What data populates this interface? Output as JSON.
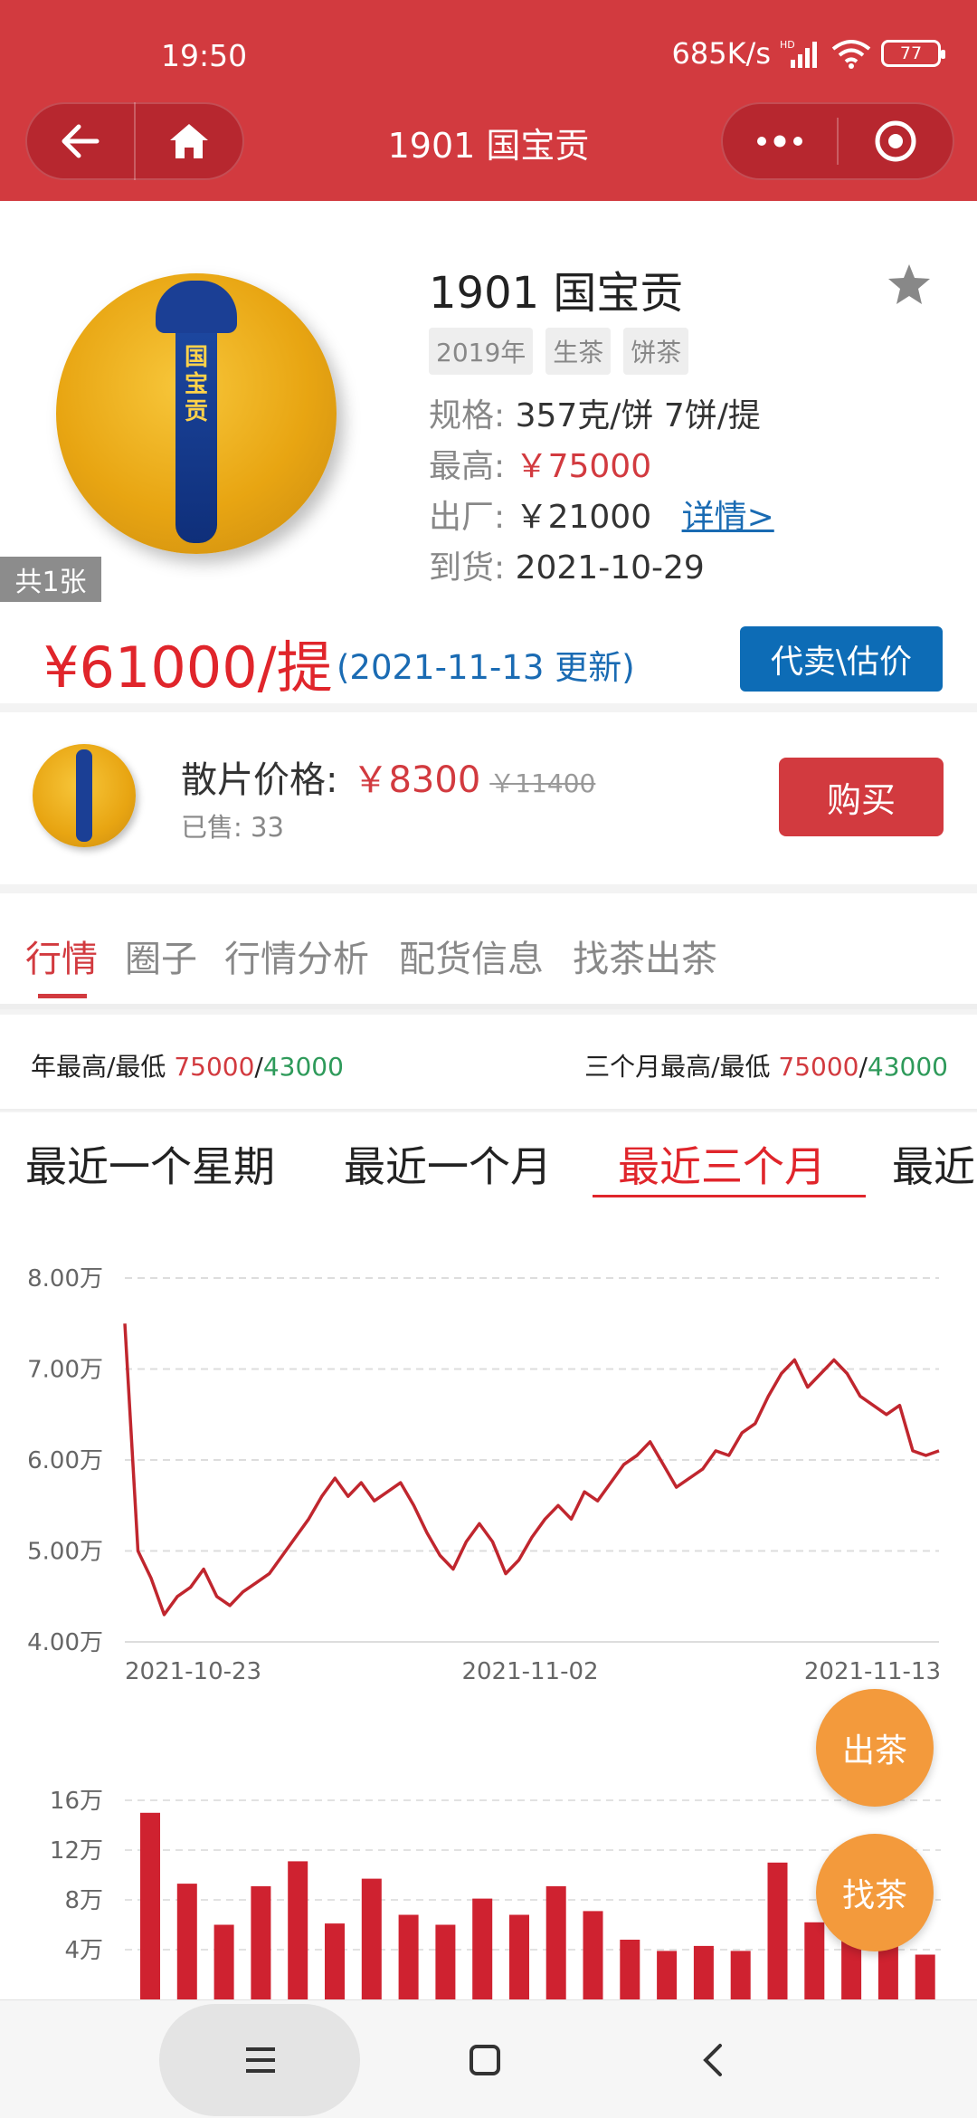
{
  "status": {
    "time": "19:50",
    "network": "685K/s",
    "hd": "HD",
    "battery": "77"
  },
  "nav": {
    "title": "1901 国宝贡"
  },
  "product": {
    "photo_count": "共1张",
    "title": "1901 国宝贡",
    "tags": [
      "2019年",
      "生茶",
      "饼茶"
    ],
    "spec_label": "规格:",
    "spec_value": "357克/饼 7饼/提",
    "max_label": "最高:",
    "max_value": "￥75000",
    "factory_label": "出厂:",
    "factory_value": "￥21000",
    "detail_link": "详情>",
    "arrival_label": "到货:",
    "arrival_value": "2021-10-29",
    "price": "¥61000/提",
    "updated": "(2021-11-13 更新)",
    "consign_button": "代卖\\估价"
  },
  "loose": {
    "label": "散片价格:",
    "price": "￥8300",
    "old_price": "￥11400",
    "sold": "已售: 33",
    "buy_button": "购买"
  },
  "tabs": [
    "行情",
    "圈子",
    "行情分析",
    "配货信息",
    "找茶出茶"
  ],
  "range": {
    "year_label": "年最高/最低",
    "year_high": "75000",
    "year_low": "43000",
    "quarter_label": "三个月最高/最低",
    "quarter_high": "75000",
    "quarter_low": "43000",
    "sep": "/"
  },
  "periods": [
    "最近一个星期",
    "最近一个月",
    "最近三个月",
    "最近"
  ],
  "chart_data": [
    {
      "type": "line",
      "y_ticks": [
        "8.00万",
        "7.00万",
        "6.00万",
        "5.00万",
        "4.00万"
      ],
      "x_ticks": [
        "2021-10-23",
        "2021-11-02",
        "2021-11-13"
      ],
      "ylim": [
        40000,
        80000
      ],
      "grid": true,
      "values": [
        75000,
        50000,
        47000,
        43000,
        45000,
        46000,
        48000,
        45000,
        44000,
        45500,
        46500,
        47500,
        49500,
        51500,
        53500,
        56000,
        58000,
        56000,
        57500,
        55500,
        56500,
        57500,
        55000,
        52000,
        49500,
        48000,
        51000,
        53000,
        51000,
        47500,
        49000,
        51500,
        53500,
        55000,
        53500,
        56500,
        55500,
        57500,
        59500,
        60500,
        62000,
        59500,
        57000,
        58000,
        59000,
        61000,
        60500,
        63000,
        64000,
        67000,
        69500,
        71000,
        68000,
        69500,
        71000,
        69500,
        67000,
        66000,
        65000,
        66000,
        61000,
        60500,
        61000
      ]
    },
    {
      "type": "bar",
      "y_ticks": [
        "16万",
        "12万",
        "8万",
        "4万"
      ],
      "ylim": [
        0,
        160000
      ],
      "grid": true,
      "values": [
        150000,
        93000,
        60000,
        91000,
        111000,
        61000,
        97000,
        68000,
        60000,
        81000,
        68000,
        91000,
        71000,
        48000,
        39000,
        43000,
        39000,
        110000,
        62000,
        49000,
        49000,
        36000
      ]
    }
  ],
  "float": {
    "sell": "出茶",
    "find": "找茶"
  },
  "colors": {
    "brand": "#d23a3f",
    "price": "#e0252b",
    "blue": "#0d6cb6",
    "orange": "#f39a3c",
    "line": "#c0262e",
    "bar": "#cf2230",
    "green": "#2e9a5a"
  }
}
